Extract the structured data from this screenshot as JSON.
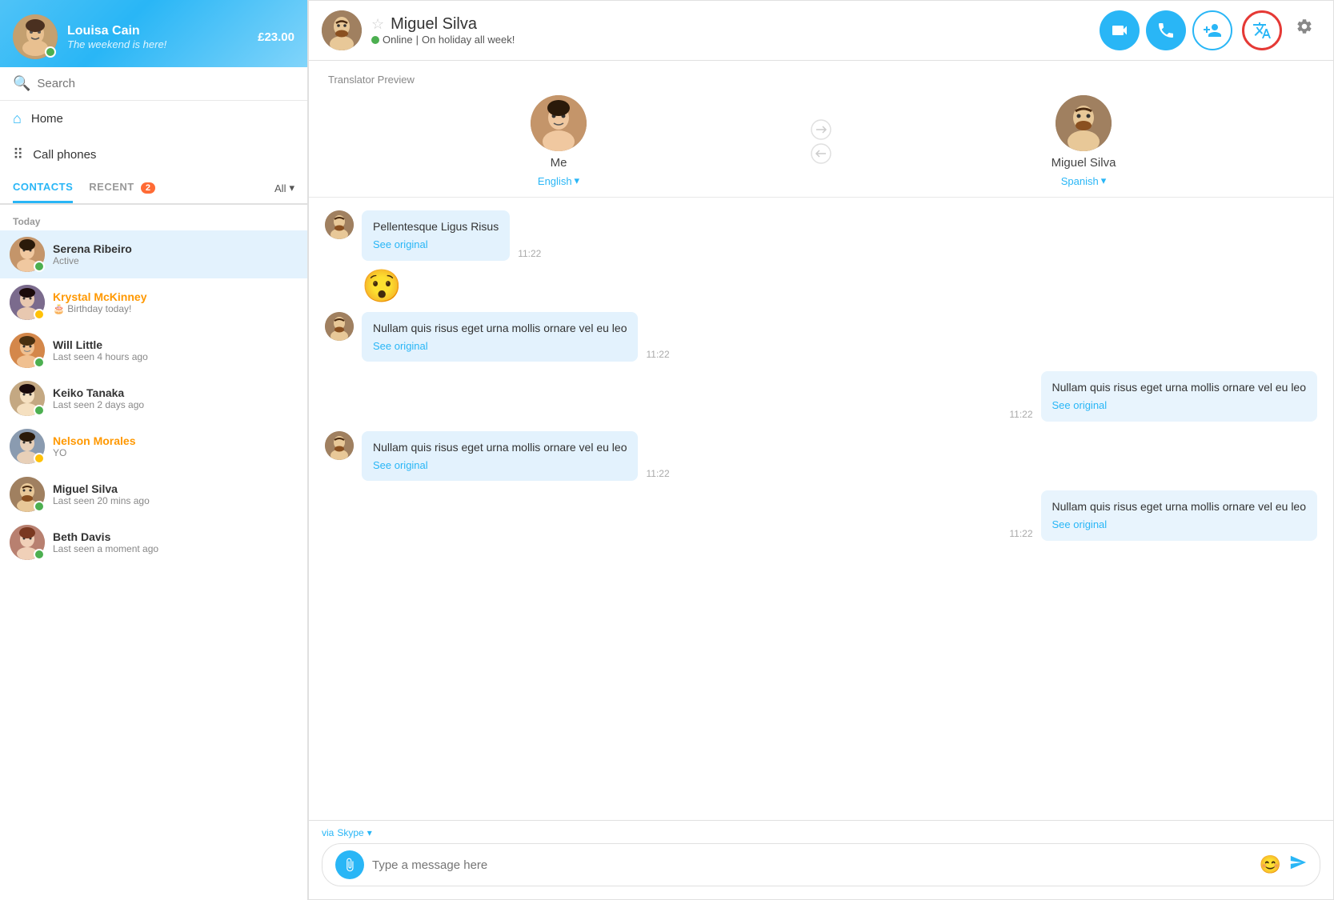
{
  "app": {
    "title": "Skype"
  },
  "sidebar": {
    "user": {
      "name": "Louisa Cain",
      "status": "The weekend is here!",
      "credit": "£23.00",
      "status_type": "online"
    },
    "search": {
      "placeholder": "Search"
    },
    "nav": {
      "home": "Home",
      "call_phones": "Call phones"
    },
    "tabs": {
      "contacts": "CONTACTS",
      "recent": "RECENT",
      "recent_count": "2",
      "all": "All"
    },
    "section_today": "Today",
    "contacts": [
      {
        "name": "Serena Ribeiro",
        "sub": "Active",
        "status": "online",
        "selected": true,
        "av": "av-serena"
      },
      {
        "name": "Krystal McKinney",
        "sub": "Birthday today!",
        "status": "away",
        "selected": false,
        "av": "av-krystal",
        "online_name": true
      },
      {
        "name": "Will Little",
        "sub": "Last seen 4 hours ago",
        "status": "online",
        "selected": false,
        "av": "av-will"
      },
      {
        "name": "Keiko Tanaka",
        "sub": "Last seen 2 days ago",
        "status": "online",
        "selected": false,
        "av": "av-keiko"
      },
      {
        "name": "Nelson Morales",
        "sub": "YO",
        "status": "away",
        "selected": false,
        "av": "av-nelson",
        "online_name": true
      },
      {
        "name": "Miguel Silva",
        "sub": "Last seen 20 mins ago",
        "status": "online",
        "selected": false,
        "av": "av-miguel"
      },
      {
        "name": "Beth Davis",
        "sub": "Last seen a moment ago",
        "status": "online",
        "selected": false,
        "av": "av-beth"
      }
    ]
  },
  "chat": {
    "contact_name": "Miguel Silva",
    "status": "Online",
    "status_detail": "On holiday all week!",
    "translator_preview_label": "Translator Preview",
    "me": {
      "name": "Me",
      "language": "English"
    },
    "contact": {
      "name": "Miguel Silva",
      "language": "Spanish"
    },
    "messages": [
      {
        "side": "left",
        "text": "Pellentesque Ligus Risus",
        "see_original": "See original",
        "time": "11:22"
      },
      {
        "side": "emoji",
        "text": "🤯"
      },
      {
        "side": "left",
        "text": "Nullam quis risus eget urna mollis ornare vel eu leo",
        "see_original": "See original",
        "time": "11:22"
      },
      {
        "side": "right",
        "text": "Nullam quis risus eget urna mollis ornare vel eu leo",
        "see_original": "See original",
        "time": "11:22"
      },
      {
        "side": "left",
        "text": "Nullam quis risus eget urna mollis ornare vel eu leo",
        "see_original": "See original",
        "time": "11:22"
      },
      {
        "side": "right",
        "text": "Nullam quis risus eget urna mollis ornare vel eu leo",
        "see_original": "See original",
        "time": "11:22"
      }
    ],
    "input": {
      "placeholder": "Type a message here",
      "via_label": "via",
      "via_service": "Skype"
    },
    "actions": {
      "video_call": "video-call",
      "voice_call": "voice-call",
      "add_contact": "add-contact",
      "translator": "translator",
      "settings": "settings"
    }
  }
}
